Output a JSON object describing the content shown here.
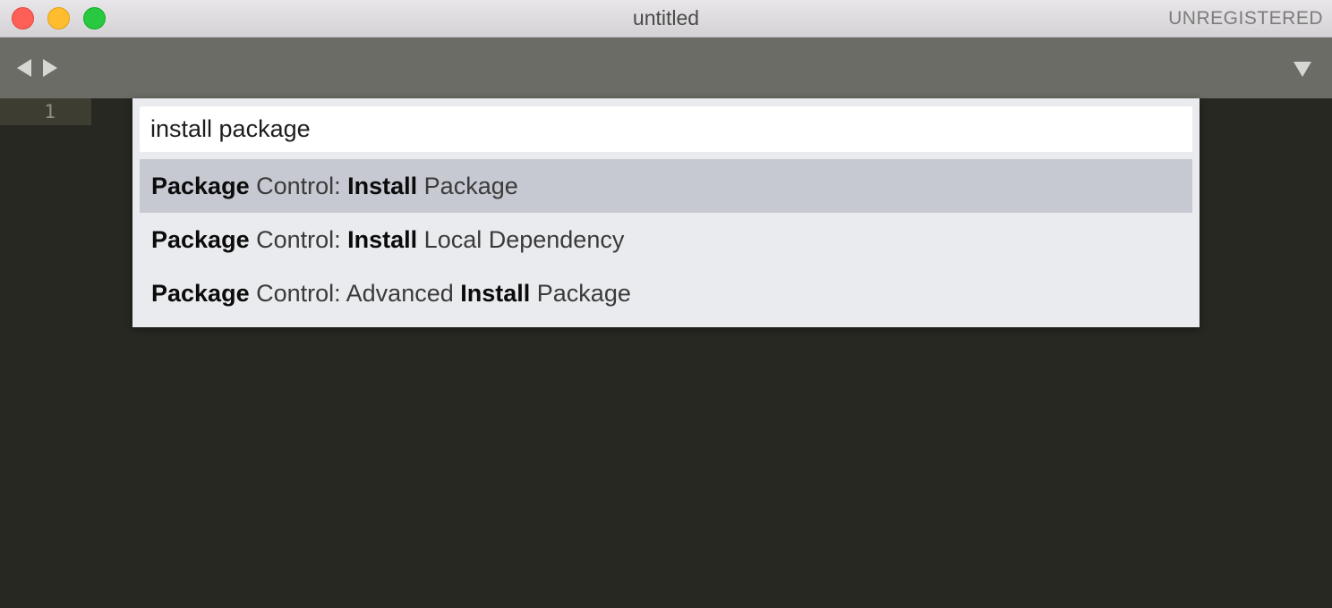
{
  "window": {
    "title": "untitled",
    "status": "UNREGISTERED"
  },
  "editor": {
    "line_number": "1"
  },
  "palette": {
    "query": "install package",
    "results": [
      [
        {
          "text": "Package",
          "bold": true
        },
        {
          "text": " Control: ",
          "bold": false
        },
        {
          "text": "Install",
          "bold": true
        },
        {
          "text": " Package",
          "bold": false
        }
      ],
      [
        {
          "text": "Package",
          "bold": true
        },
        {
          "text": " Control: ",
          "bold": false
        },
        {
          "text": "Install",
          "bold": true
        },
        {
          "text": " Local Dependency",
          "bold": false
        }
      ],
      [
        {
          "text": "Package",
          "bold": true
        },
        {
          "text": " Control: Advanced ",
          "bold": false
        },
        {
          "text": "Install",
          "bold": true
        },
        {
          "text": " Package",
          "bold": false
        }
      ]
    ],
    "selected_index": 0
  },
  "icons": {
    "nav_back": "chevron-left-icon",
    "nav_forward": "chevron-right-icon",
    "tab_menu": "triangle-down-icon"
  },
  "colors": {
    "editor_bg": "#272822",
    "selected_row": "#c6c9d2"
  }
}
